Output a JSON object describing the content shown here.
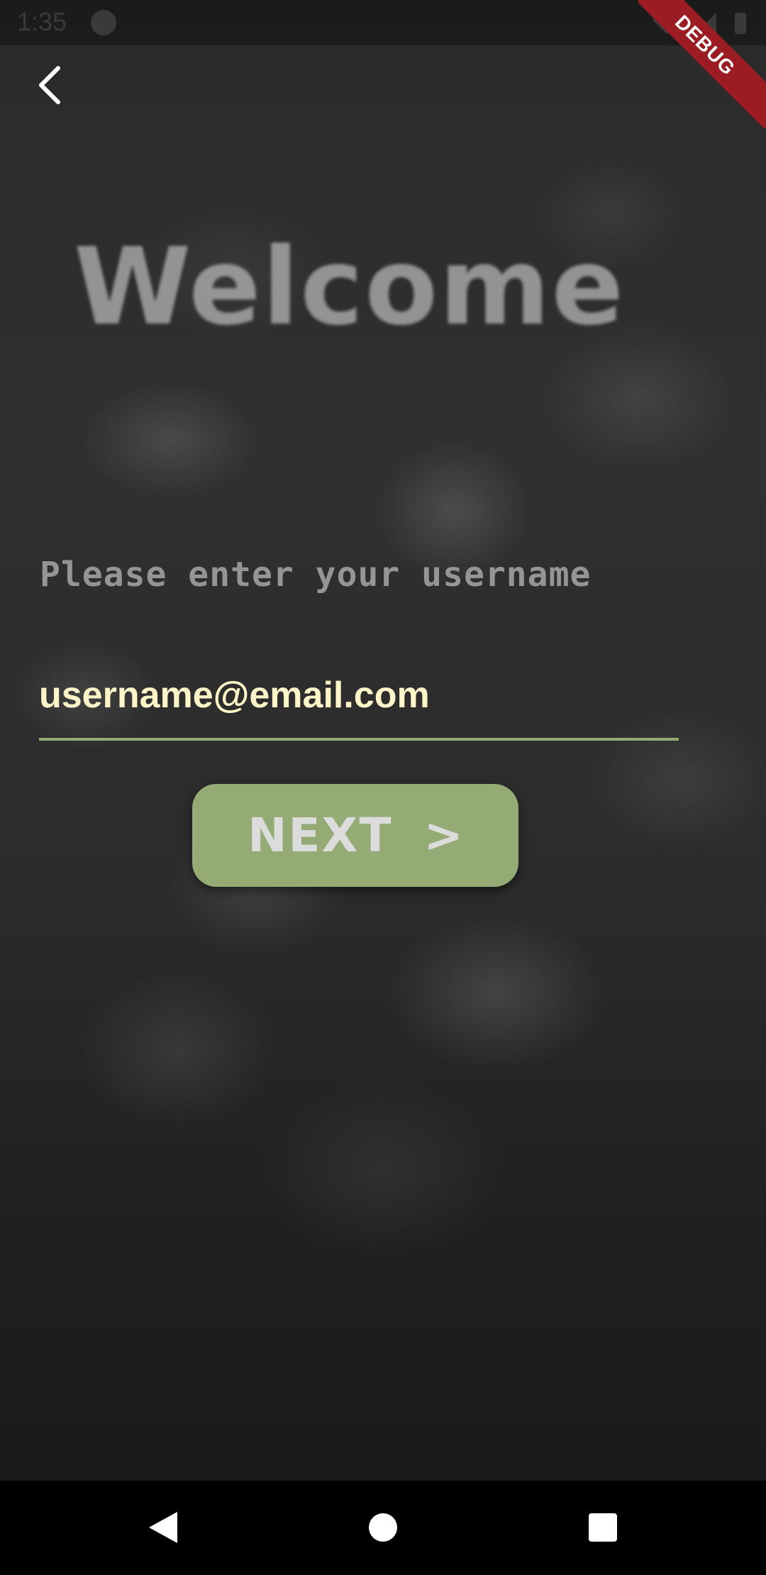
{
  "status_bar": {
    "time": "1:35"
  },
  "debug_banner": {
    "label": "DEBUG",
    "color": "#9b1c22"
  },
  "header": {
    "back_icon": "chevron-left-icon"
  },
  "main": {
    "title": "Welcome",
    "prompt": "Please enter your username",
    "username_input": {
      "value": "username@email.com",
      "text_color": "#fff5c8",
      "underline_color": "#95ab76"
    },
    "next_button": {
      "label": "NEXT",
      "chevron": ">",
      "color": "#95ab76"
    }
  },
  "nav_bar": {
    "items": [
      {
        "icon": "triangle-back-icon"
      },
      {
        "icon": "circle-home-icon"
      },
      {
        "icon": "square-recents-icon"
      }
    ]
  }
}
